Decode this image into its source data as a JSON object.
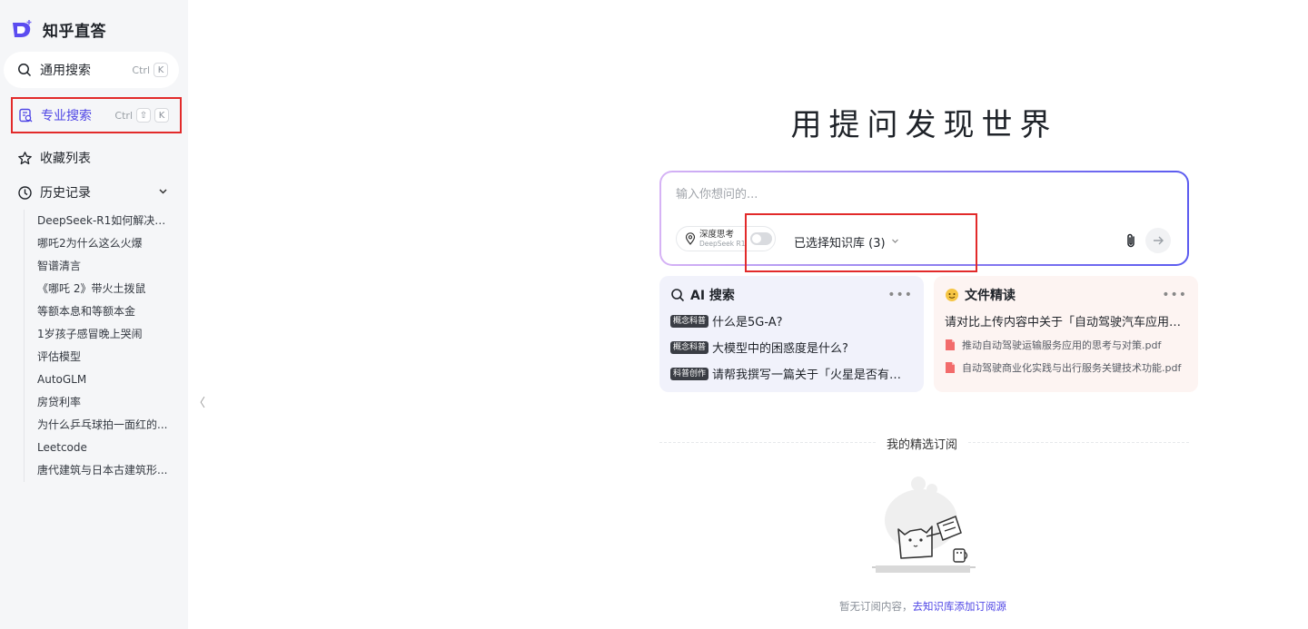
{
  "brand": {
    "name": "知乎直答",
    "logo": "zhida-logo-icon"
  },
  "sidebar": {
    "general_search": {
      "label": "通用搜索",
      "shortcut_ctrl": "Ctrl",
      "shortcut_key": "K"
    },
    "pro_search": {
      "label": "专业搜索",
      "shortcut_ctrl": "Ctrl",
      "shortcut_shift": "⇧",
      "shortcut_key": "K"
    },
    "favorites": {
      "label": "收藏列表"
    },
    "history": {
      "label": "历史记录",
      "items": [
        "DeepSeek-R1如何解决语...",
        "哪吒2为什么这么火爆",
        "智谱清言",
        "《哪吒 2》带火土拨鼠",
        "等额本息和等额本金",
        "1岁孩子感冒晚上哭闹",
        "评估模型",
        "AutoGLM",
        "房贷利率",
        "为什么乒乓球拍一面红的...",
        "Leetcode",
        "唐代建筑与日本古建筑形..."
      ]
    },
    "collapse": "〈"
  },
  "main": {
    "title": "用提问发现世界",
    "ask": {
      "placeholder": "输入你想问的...",
      "deep_think_label": "深度思考",
      "deep_think_model": "DeepSeek R1",
      "deep_think_on": false,
      "kb_select": "已选择知识库 (3)"
    },
    "cards": {
      "ai": {
        "title": "AI 搜索",
        "more": "•••",
        "rows": [
          {
            "tag": "概念科普",
            "text": "什么是5G-A?"
          },
          {
            "tag": "概念科普",
            "text": "大模型中的困惑度是什么?"
          },
          {
            "tag": "科普创作",
            "text": "请帮我撰写一篇关于「火星是否有过生..."
          }
        ]
      },
      "file": {
        "title": "文件精读",
        "more": "•••",
        "question": "请对比上传内容中关于「自动驾驶汽车应用障...",
        "files": [
          "推动自动驾驶运输服务应用的思考与对策.pdf",
          "自动驾驶商业化实践与出行服务关键技术功能.pdf"
        ]
      }
    },
    "subscriptions": {
      "title": "我的精选订阅",
      "empty_text": "暂无订阅内容，",
      "empty_link": "去知识库添加订阅源"
    }
  },
  "colors": {
    "accent": "#4f46e5",
    "highlight": "#e22a2a",
    "sidebar_bg": "#f5f6f8"
  }
}
